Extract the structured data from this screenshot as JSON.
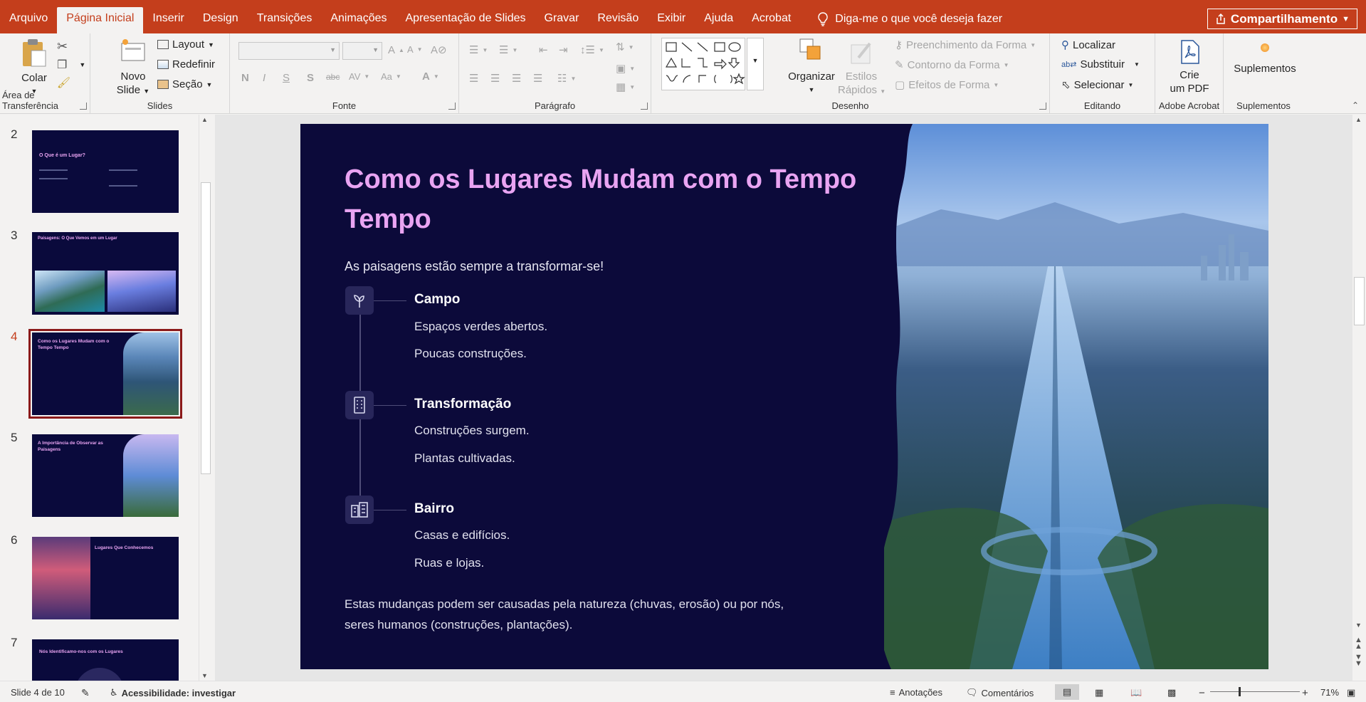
{
  "tabs": [
    {
      "label": "Arquivo"
    },
    {
      "label": "Página Inicial"
    },
    {
      "label": "Inserir"
    },
    {
      "label": "Design"
    },
    {
      "label": "Transições"
    },
    {
      "label": "Animações"
    },
    {
      "label": "Apresentação de Slides"
    },
    {
      "label": "Gravar"
    },
    {
      "label": "Revisão"
    },
    {
      "label": "Exibir"
    },
    {
      "label": "Ajuda"
    },
    {
      "label": "Acrobat"
    }
  ],
  "tell_me": "Diga-me o que você deseja fazer",
  "share_label": "Compartilhamento",
  "ribbon": {
    "clipboard": {
      "paste": "Colar",
      "group": "Área de Transferência"
    },
    "slides": {
      "new_slide_1": "Novo",
      "new_slide_2": "Slide",
      "layout": "Layout",
      "reset": "Redefinir",
      "section": "Seção",
      "group": "Slides"
    },
    "font": {
      "group": "Fonte",
      "bold": "N",
      "italic": "I",
      "underline": "S",
      "shadow": "S",
      "strike": "abc"
    },
    "paragraph": {
      "group": "Parágrafo"
    },
    "drawing": {
      "arrange": "Organizar",
      "quick_styles_1": "Estilos",
      "quick_styles_2": "Rápidos",
      "fill": "Preenchimento da Forma",
      "outline": "Contorno da Forma",
      "effects": "Efeitos de Forma",
      "group": "Desenho"
    },
    "editing": {
      "find": "Localizar",
      "replace": "Substituir",
      "select": "Selecionar",
      "group": "Editando"
    },
    "acrobat": {
      "create_1": "Crie",
      "create_2": "um PDF",
      "group": "Adobe Acrobat"
    },
    "addins": {
      "label": "Suplementos",
      "group": "Suplementos"
    }
  },
  "thumbnails": [
    {
      "num": "2",
      "title": "O Que é um Lugar?"
    },
    {
      "num": "3",
      "title": "Paisagens: O Que Vemos em um Lugar"
    },
    {
      "num": "4",
      "title": "Como os Lugares Mudam com o Tempo Tempo"
    },
    {
      "num": "5",
      "title": "A Importância de Observar as Paisagens"
    },
    {
      "num": "6",
      "title": "Lugares Que Conhecemos"
    },
    {
      "num": "7",
      "title": "Nós Identificamo-nos com os Lugares"
    }
  ],
  "slide": {
    "title_line1": "Como os Lugares Mudam com o Tempo",
    "title_line2": "Tempo",
    "subtitle": "As paisagens estão sempre a transformar-se!",
    "items": [
      {
        "heading": "Campo",
        "line1": "Espaços verdes abertos.",
        "line2": "Poucas construções.",
        "icon": "sprout-icon"
      },
      {
        "heading": "Transformação",
        "line1": "Construções surgem.",
        "line2": "Plantas cultivadas.",
        "icon": "building-icon"
      },
      {
        "heading": "Bairro",
        "line1": "Casas e edifícios.",
        "line2": "Ruas e lojas.",
        "icon": "city-icon"
      }
    ],
    "footer_line1": "Estas mudanças podem ser causadas pela natureza (chuvas, erosão) ou por nós,",
    "footer_line2": "seres humanos (construções, plantações)."
  },
  "status": {
    "slide_count": "Slide 4 de 10",
    "accessibility": "Acessibilidade: investigar",
    "notes": "Anotações",
    "comments": "Comentários",
    "zoom": "71%"
  },
  "colors": {
    "accent": "#c43e1c",
    "slide_bg": "#0c0a3a",
    "title": "#e9a4f2"
  }
}
